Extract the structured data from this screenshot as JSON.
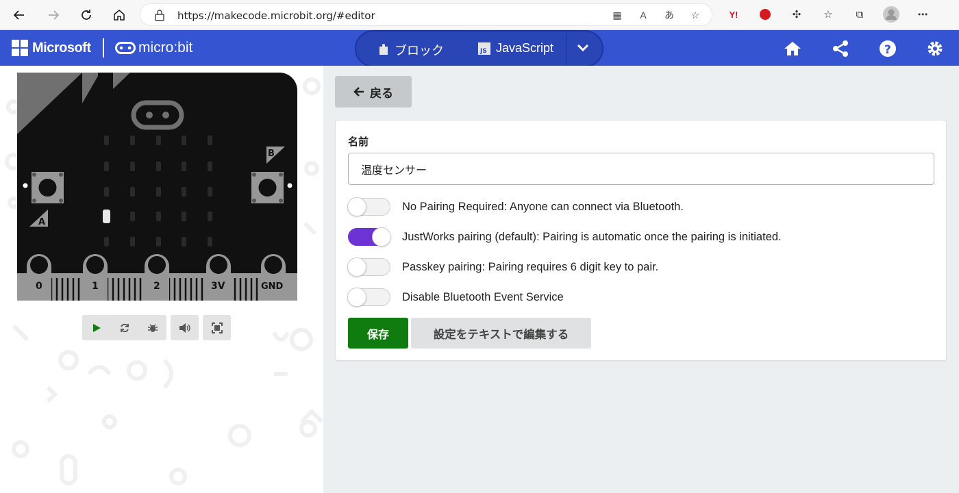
{
  "browser": {
    "url": "https://makecode.microbit.org/#editor"
  },
  "header": {
    "microsoft_label": "Microsoft",
    "microbit_label": "micro:bit",
    "tabs": [
      {
        "label": "ブロック",
        "icon": "puzzle-icon"
      },
      {
        "label": "JavaScript",
        "icon": "js-icon"
      }
    ],
    "colors": {
      "header_bg": "#3454d1",
      "toggle_bg": "#2a46b6"
    }
  },
  "simulator": {
    "pin_labels": [
      "0",
      "1",
      "2",
      "3V",
      "GND"
    ],
    "button_a": "A",
    "button_b": "B"
  },
  "editor": {
    "back_label": "戻る",
    "name_label": "名前",
    "name_value": "温度センサー",
    "options": [
      {
        "label": "No Pairing Required: Anyone can connect via Bluetooth.",
        "on": false
      },
      {
        "label": "JustWorks pairing (default): Pairing is automatic once the pairing is initiated.",
        "on": true
      },
      {
        "label": "Passkey pairing: Pairing requires 6 digit key to pair.",
        "on": false
      },
      {
        "label": "Disable Bluetooth Event Service",
        "on": false
      }
    ],
    "save_label": "保存",
    "edit_text_label": "設定をテキストで編集する",
    "colors": {
      "save_bg": "#107c10",
      "toggle_on": "#6d33d4"
    }
  }
}
